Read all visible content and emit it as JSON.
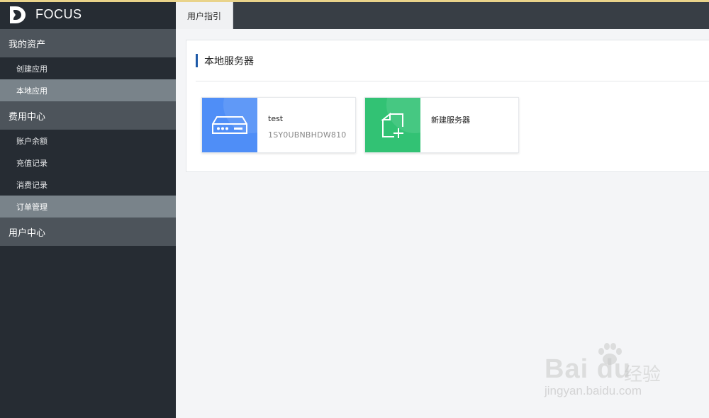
{
  "brand": {
    "name": "FOCUS"
  },
  "sidebar": {
    "groups": [
      {
        "label": "我的资产",
        "items": [
          {
            "label": "创建应用"
          },
          {
            "label": "本地应用"
          }
        ]
      },
      {
        "label": "费用中心",
        "items": [
          {
            "label": "账户余额"
          },
          {
            "label": "充值记录"
          },
          {
            "label": "消费记录"
          },
          {
            "label": "订单管理"
          }
        ]
      },
      {
        "label": "用户中心",
        "items": []
      }
    ]
  },
  "tabs": [
    {
      "label": "用户指引"
    }
  ],
  "panel": {
    "title": "本地服务器",
    "cards": [
      {
        "name": "test",
        "serial": "1SY0UBNBHDW810",
        "color": "#4f8ef7",
        "icon": "server-icon"
      },
      {
        "name": "新建服务器",
        "color": "#32c274",
        "icon": "add-document-icon"
      }
    ]
  },
  "watermark": {
    "brand": "Bai du",
    "cn": "经验",
    "url": "jingyan.baidu.com"
  },
  "colors": {
    "sidebar_bg": "#262c33",
    "group_bg": "#4d545b",
    "active_item_bg": "#79838a",
    "accent": "#1e5aa8"
  }
}
